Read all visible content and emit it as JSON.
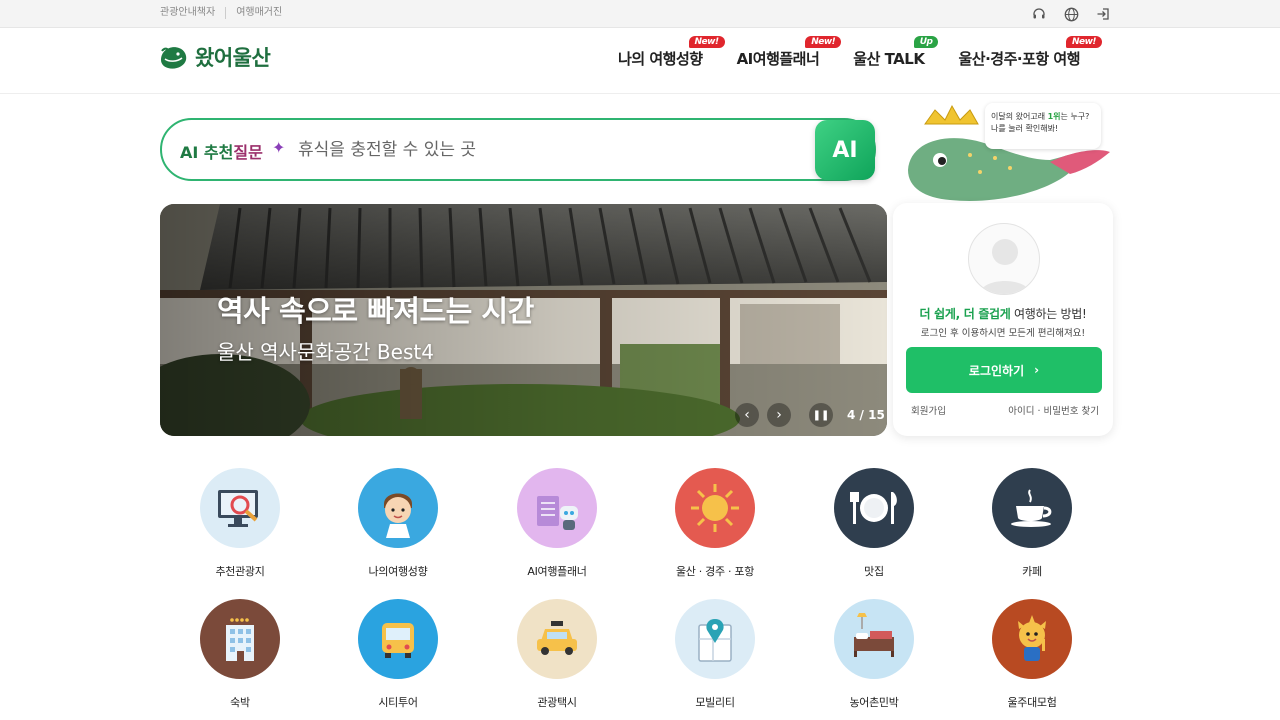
{
  "utility": {
    "links": [
      "관광안내책자",
      "여행매거진"
    ],
    "icons": [
      "headset-icon",
      "globe-icon",
      "login-icon"
    ]
  },
  "header": {
    "logo_text": "왔어울산",
    "nav": [
      {
        "label": "나의 여행성향",
        "badge": "New!",
        "badge_color": "#e0262d"
      },
      {
        "label": "AI여행플래너",
        "badge": "New!",
        "badge_color": "#e0262d"
      },
      {
        "label": "울산 TALK",
        "badge": "Up",
        "badge_color": "#2aa345"
      },
      {
        "label": "울산·경주·포항 여행",
        "badge": "New!",
        "badge_color": "#e0262d"
      }
    ]
  },
  "search": {
    "prefix_a": "AI 추천",
    "prefix_b": "질문",
    "placeholder": "휴식을 충전할 수 있는 곳",
    "ai_button": "AI"
  },
  "banner": {
    "title": "역사 속으로 빠져드는 시간",
    "subtitle": "울산 역사문화공간 Best4",
    "counter": "4 / 15"
  },
  "mascot": {
    "speech_line1_pre": "이달의 왔어고래 ",
    "speech_highlight": "1위",
    "speech_line1_post": "는 누구?",
    "speech_line2": "나를 눌러 확인해봐!"
  },
  "login": {
    "line1_highlight": "더 쉽게, 더 즐겁게",
    "line1_rest": " 여행하는 방법!",
    "line2": "로그인 후 이용하시면 모든게 편리해져요!",
    "button": "로그인하기",
    "signup": "회원가입",
    "find": "아이디 · 비밀번호 찾기"
  },
  "categories": [
    {
      "label": "추천관광지",
      "icon": "monitor-search-icon",
      "bg": "#dcecf6"
    },
    {
      "label": "나의여행성향",
      "icon": "traveler-face-icon",
      "bg": "#3aa8e0"
    },
    {
      "label": "AI여행플래너",
      "icon": "robot-planner-icon",
      "bg": "#e2b6ee"
    },
    {
      "label": "울산 · 경주 · 포항",
      "icon": "sun-icon",
      "bg": "#e45a50"
    },
    {
      "label": "맛집",
      "icon": "plate-cutlery-icon",
      "bg": "#2f3e4e"
    },
    {
      "label": "카페",
      "icon": "coffee-cup-icon",
      "bg": "#2f3e4e"
    },
    {
      "label": "숙박",
      "icon": "hotel-icon",
      "bg": "#7b4a3a"
    },
    {
      "label": "시티투어",
      "icon": "bus-icon",
      "bg": "#2aa3e0"
    },
    {
      "label": "관광택시",
      "icon": "taxi-icon",
      "bg": "#f0e2c6"
    },
    {
      "label": "모빌리티",
      "icon": "map-pin-icon",
      "bg": "#dcecf6"
    },
    {
      "label": "농어촌민박",
      "icon": "bed-icon",
      "bg": "#c7e4f4"
    },
    {
      "label": "울주대모험",
      "icon": "mascot-character-icon",
      "bg": "#b84a22"
    }
  ]
}
